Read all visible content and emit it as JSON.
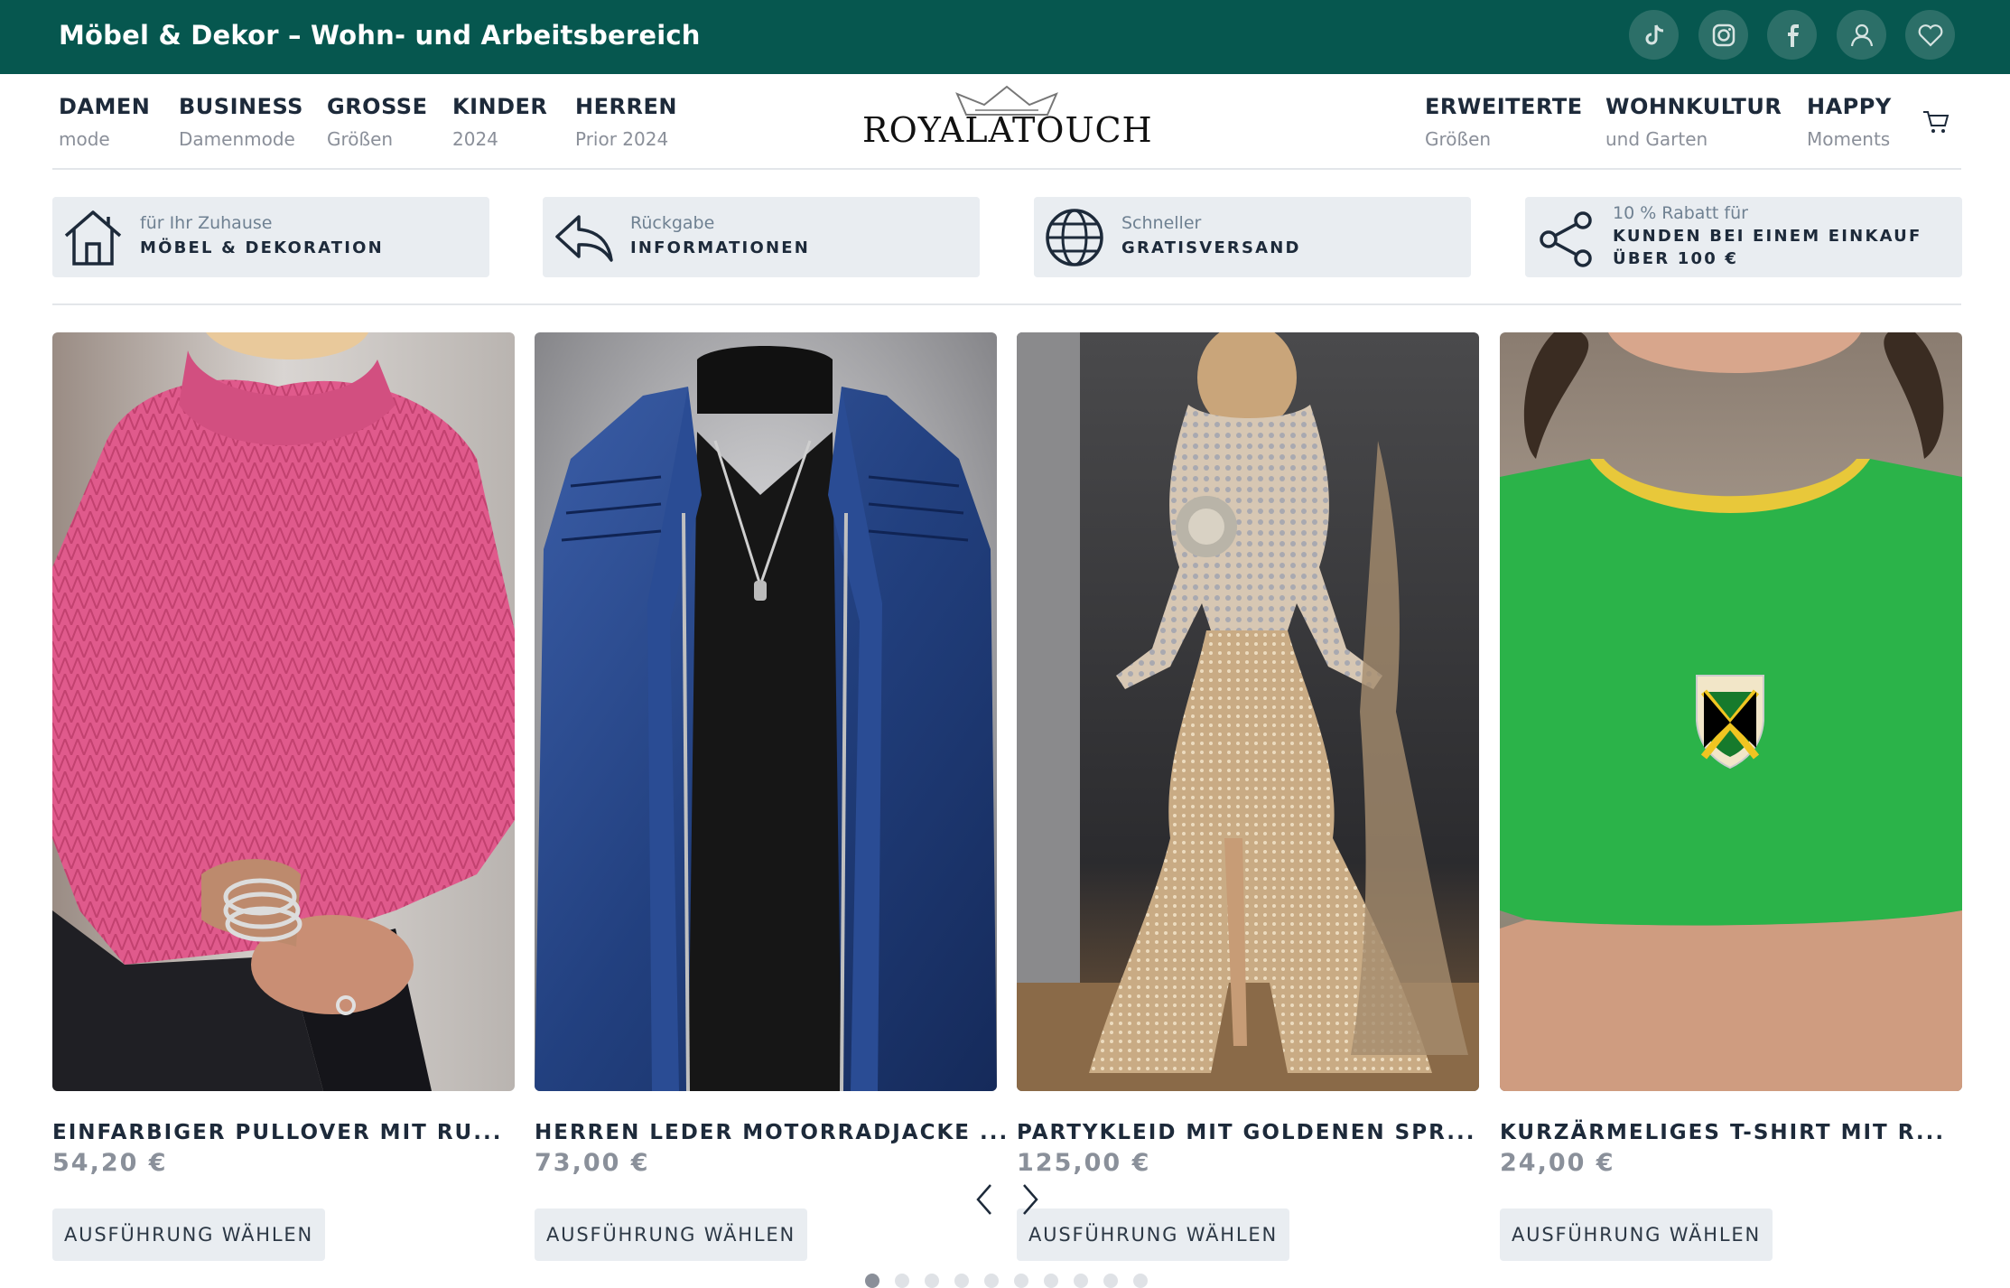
{
  "topbar": {
    "title": "Möbel & Dekor – Wohn- und Arbeitsbereich",
    "icons": [
      "tiktok-icon",
      "instagram-icon",
      "facebook-icon",
      "user-icon",
      "heart-icon"
    ],
    "color": "#06574f"
  },
  "nav": {
    "left": [
      {
        "main": "DAMEN",
        "sub": "mode"
      },
      {
        "main": "BUSINESS",
        "sub": "Damenmode"
      },
      {
        "main": "GROSSE",
        "sub": "Größen"
      },
      {
        "main": "KINDER",
        "sub": "2024"
      },
      {
        "main": "HERREN",
        "sub": "Prior 2024"
      }
    ],
    "right": [
      {
        "main": "ERWEITERTE",
        "sub": "Größen"
      },
      {
        "main": "WOHNKULTUR",
        "sub": "und Garten"
      },
      {
        "main": "HAPPY",
        "sub": "Moments"
      }
    ],
    "logo_text": "ROYALATOUCH"
  },
  "features": [
    {
      "icon": "house-icon",
      "small": "für Ihr Zuhause",
      "lines": [
        "MÖBEL & DEKORATION"
      ]
    },
    {
      "icon": "reply-arrow-icon",
      "small": "Rückgabe",
      "lines": [
        "INFORMATIONEN"
      ]
    },
    {
      "icon": "globe-icon",
      "small": "Schneller",
      "lines": [
        "GRATISVERSAND"
      ]
    },
    {
      "icon": "share-icon",
      "small": "10 % Rabatt für",
      "lines": [
        "KUNDEN BEI EINEM EINKAUF",
        "ÜBER 100 €"
      ]
    }
  ],
  "products": [
    {
      "title": "EINFARBIGER PULLOVER MIT RU...",
      "price": "54,20 €",
      "button": "AUSFÜHRUNG WÄHLEN"
    },
    {
      "title": "HERREN LEDER MOTORRADJACKE ...",
      "price": "73,00 €",
      "button": "AUSFÜHRUNG WÄHLEN"
    },
    {
      "title": "PARTYKLEID MIT GOLDENEN SPR...",
      "price": "125,00 €",
      "button": "AUSFÜHRUNG WÄHLEN"
    },
    {
      "title": "KURZÄRMELIGES T-SHIRT MIT R...",
      "price": "24,00 €",
      "button": "AUSFÜHRUNG WÄHLEN"
    }
  ],
  "carousel": {
    "dot_count": 10,
    "active_index": 0
  }
}
